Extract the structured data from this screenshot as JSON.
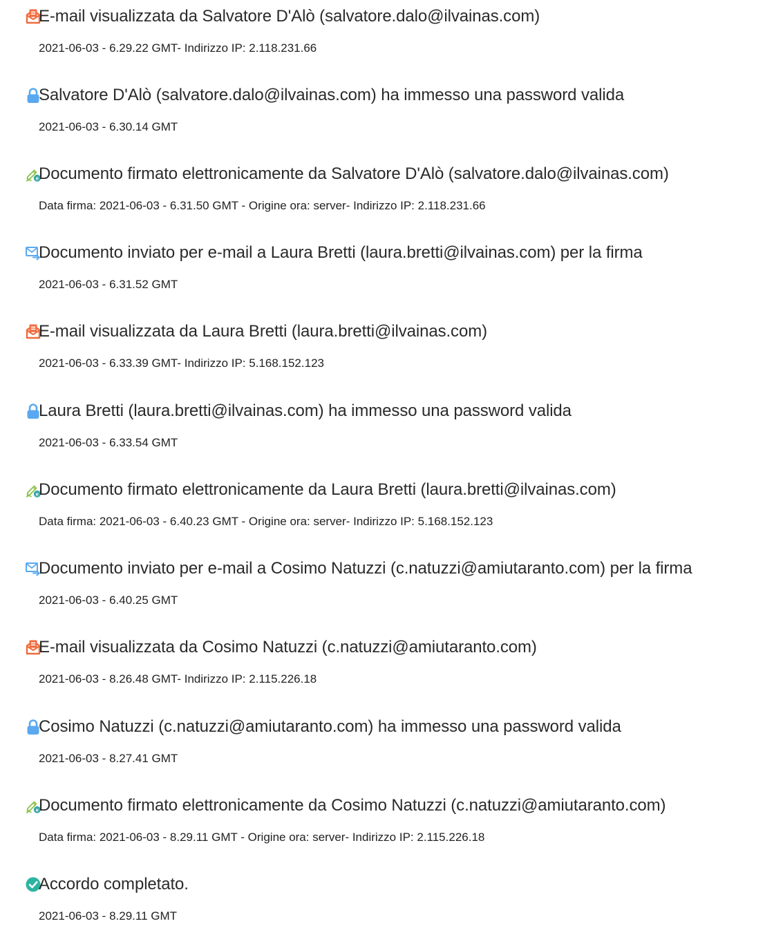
{
  "colors": {
    "viewed_icon": "#f06b3d",
    "lock_icon": "#5aa9f0",
    "signed_pen_icon": "#8ec24e",
    "signed_badge": "#3aa9a6",
    "sent_icon": "#5aa9f0",
    "completed_icon": "#2bb5a0"
  },
  "events": [
    {
      "icon": "email-viewed-icon",
      "title": "E-mail visualizzata da Salvatore D'Alò (salvatore.dalo@ilvainas.com)",
      "detail": "2021-06-03 - 6.29.22 GMT- Indirizzo IP: 2.118.231.66"
    },
    {
      "icon": "lock-icon",
      "title": "Salvatore D'Alò (salvatore.dalo@ilvainas.com) ha immesso una password valida",
      "detail": "2021-06-03 - 6.30.14 GMT"
    },
    {
      "icon": "e-signature-icon",
      "title": "Documento firmato elettronicamente da Salvatore D'Alò (salvatore.dalo@ilvainas.com)",
      "detail": "Data firma: 2021-06-03 - 6.31.50 GMT - Origine ora: server- Indirizzo IP: 2.118.231.66"
    },
    {
      "icon": "email-sent-icon",
      "title": "Documento inviato per e-mail a Laura Bretti (laura.bretti@ilvainas.com) per la firma",
      "detail": "2021-06-03 - 6.31.52 GMT"
    },
    {
      "icon": "email-viewed-icon",
      "title": "E-mail visualizzata da Laura Bretti (laura.bretti@ilvainas.com)",
      "detail": "2021-06-03 - 6.33.39 GMT- Indirizzo IP: 5.168.152.123"
    },
    {
      "icon": "lock-icon",
      "title": "Laura Bretti (laura.bretti@ilvainas.com) ha immesso una password valida",
      "detail": "2021-06-03 - 6.33.54 GMT"
    },
    {
      "icon": "e-signature-icon",
      "title": "Documento firmato elettronicamente da Laura Bretti (laura.bretti@ilvainas.com)",
      "detail": "Data firma: 2021-06-03 - 6.40.23 GMT - Origine ora: server- Indirizzo IP: 5.168.152.123"
    },
    {
      "icon": "email-sent-icon",
      "title": "Documento inviato per e-mail a Cosimo Natuzzi (c.natuzzi@amiutaranto.com) per la firma",
      "detail": "2021-06-03 - 6.40.25 GMT"
    },
    {
      "icon": "email-viewed-icon",
      "title": "E-mail visualizzata da Cosimo Natuzzi (c.natuzzi@amiutaranto.com)",
      "detail": "2021-06-03 - 8.26.48 GMT- Indirizzo IP: 2.115.226.18"
    },
    {
      "icon": "lock-icon",
      "title": "Cosimo Natuzzi (c.natuzzi@amiutaranto.com) ha immesso una password valida",
      "detail": "2021-06-03 - 8.27.41 GMT"
    },
    {
      "icon": "e-signature-icon",
      "title": "Documento firmato elettronicamente da Cosimo Natuzzi (c.natuzzi@amiutaranto.com)",
      "detail": "Data firma: 2021-06-03 - 8.29.11 GMT - Origine ora: server- Indirizzo IP: 2.115.226.18"
    },
    {
      "icon": "check-circle-icon",
      "title": "Accordo completato.",
      "detail": "2021-06-03 - 8.29.11 GMT"
    }
  ]
}
